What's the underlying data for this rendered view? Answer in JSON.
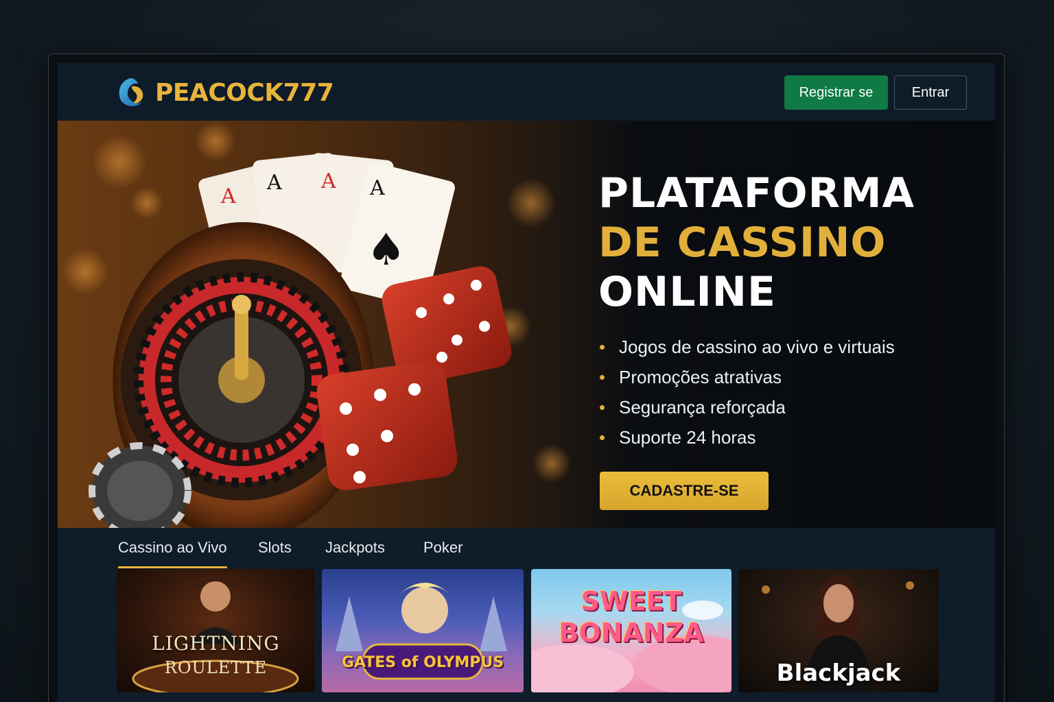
{
  "header": {
    "brand": "PEACOCK777",
    "register_label": "Registrar se",
    "login_label": "Entrar"
  },
  "hero": {
    "title_line1": "PLATAFORMA",
    "title_line2": "DE CASSINO",
    "title_line3": "ONLINE",
    "features": [
      "Jogos de cassino ao vivo e virtuais",
      "Promoções atrativas",
      "Segurança reforçada",
      "Suporte 24 horas"
    ],
    "cta_label": "CADASTRE-SE"
  },
  "tabs": [
    "Cassino ao Vivo",
    "Slots",
    "Jackpots",
    "Poker"
  ],
  "games": {
    "lightning_line1": "LIGHTNING",
    "lightning_line2": "ROULETTE",
    "olympus": "GATES of OLYMPUS",
    "sweet_line1": "SWEET",
    "sweet_line2": "BONANZA",
    "blackjack": "Blackjack"
  },
  "colors": {
    "accent_gold": "#e2b03a",
    "register_green": "#0f7a44",
    "header_bg": "#0e1b28"
  }
}
